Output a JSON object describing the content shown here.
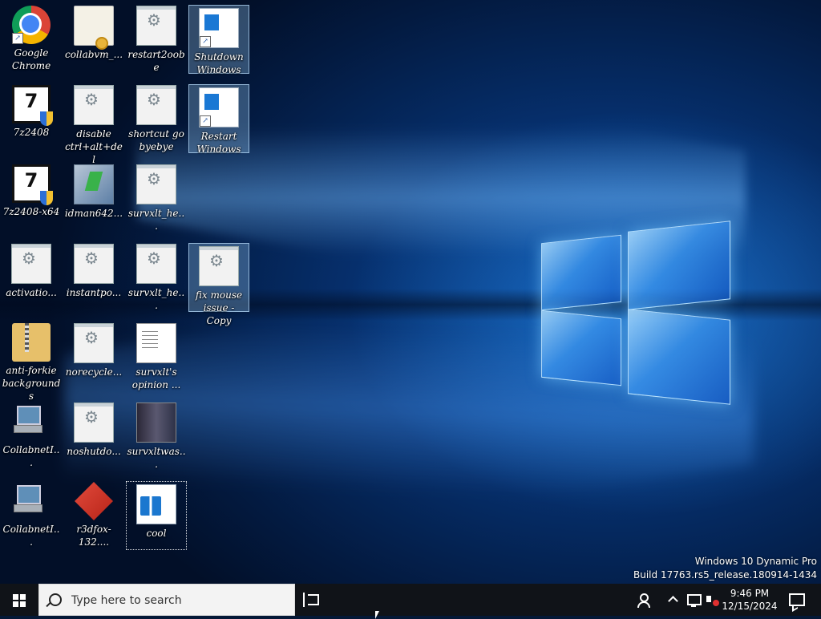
{
  "desktop": {
    "icons": [
      {
        "label": "Google Chrome",
        "glyph": "chrome-icon"
      },
      {
        "label": "collabvm_...",
        "glyph": "certificate-icon"
      },
      {
        "label": "restart2oobe",
        "glyph": "script-icon"
      },
      {
        "label": "Shutdown Windows",
        "glyph": "window-shortcut-icon"
      },
      {
        "label": "7z2408",
        "glyph": "7zip-installer-icon"
      },
      {
        "label": "disable ctrl+alt+del",
        "glyph": "script-icon"
      },
      {
        "label": "shortcut go byebye",
        "glyph": "script-icon"
      },
      {
        "label": "Restart Windows",
        "glyph": "window-shortcut-icon"
      },
      {
        "label": "7z2408-x64",
        "glyph": "7zip-installer-icon"
      },
      {
        "label": "idman642...",
        "glyph": "installer-icon"
      },
      {
        "label": "survxlt_he...",
        "glyph": "script-icon"
      },
      {
        "label": "activatio...",
        "glyph": "script-icon"
      },
      {
        "label": "instantpo...",
        "glyph": "script-icon"
      },
      {
        "label": "survxlt_he...",
        "glyph": "script-icon"
      },
      {
        "label": "fix mouse issue - Copy",
        "glyph": "script-icon"
      },
      {
        "label": "anti-forkie backgrounds",
        "glyph": "zip-folder-icon"
      },
      {
        "label": "norecycle...",
        "glyph": "script-icon"
      },
      {
        "label": "survxlt's opinion ...",
        "glyph": "text-document-icon"
      },
      {
        "label": "CollabnetI...",
        "glyph": "network-computer-icon"
      },
      {
        "label": "noshutdo...",
        "glyph": "script-icon"
      },
      {
        "label": "survxltwas...",
        "glyph": "image-thumbnail-icon"
      },
      {
        "label": "CollabnetI...",
        "glyph": "network-computer-icon"
      },
      {
        "label": "r3dfox-132....",
        "glyph": "r3dfox-icon"
      },
      {
        "label": "cool",
        "glyph": "registry-file-icon"
      }
    ]
  },
  "watermark": {
    "line1": "Windows 10 Dynamic Pro",
    "line2": "Build 17763.rs5_release.180914-1434"
  },
  "taskbar": {
    "search_placeholder": "Type here to search",
    "clock_time": "9:46 PM",
    "clock_date": "12/15/2024"
  }
}
